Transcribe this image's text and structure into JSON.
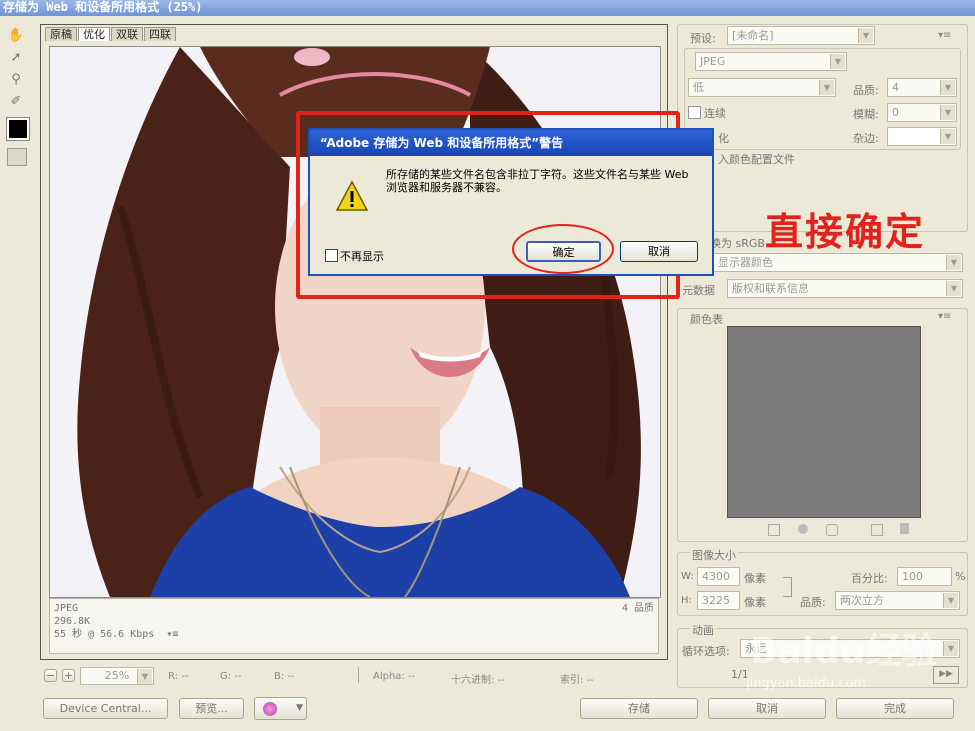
{
  "window": {
    "title": "存储为 Web 和设备所用格式 (25%)"
  },
  "tabs": [
    "原稿",
    "优化",
    "双联",
    "四联"
  ],
  "active_tab": 1,
  "info": {
    "format": "JPEG",
    "size": "296.8K",
    "time": "55 秒 @ 56.6 Kbps",
    "quality": "4 品质"
  },
  "statusbar": {
    "zoom": "25%",
    "r": "R: --",
    "g": "G: --",
    "b": "B: --",
    "alpha": "Alpha: --",
    "hex": "十六进制: --",
    "index": "索引: --"
  },
  "bottom": {
    "device_central": "Device Central...",
    "preview": "预览...",
    "save": "存储",
    "cancel": "取消",
    "done": "完成"
  },
  "right": {
    "preset_label": "预设:",
    "preset_value": "[未命名]",
    "format": "JPEG",
    "compression": "低",
    "quality_label": "品质:",
    "quality_value": "4",
    "progressive_label": "连续",
    "blur_label": "模糊:",
    "blur_value": "0",
    "optimized_partial": "化",
    "matte_label": "杂边:",
    "embed_profile": "入颜色配置文件",
    "convert_srgb": "换为 sRGB",
    "preview_value": "显示器颜色",
    "metadata_label": "元数据",
    "metadata_value": "版权和联系信息",
    "colortable_label": "颜色表",
    "image_size_label": "图像大小",
    "w_label": "W:",
    "w_value": "4300",
    "h_label": "H:",
    "h_value": "3225",
    "px_unit": "像素",
    "percent_label": "百分比:",
    "percent_value": "100",
    "percent_unit": "%",
    "resample_label": "品质:",
    "resample_value": "两次立方",
    "animation_label": "动画",
    "loop_label": "循环选项:",
    "loop_value": "永远",
    "frame_counter": "1/1"
  },
  "dialog": {
    "title": "“Adobe 存储为 Web 和设备所用格式”警告",
    "message": "所存储的某些文件名包含非拉丁字符。这些文件名与某些 Web 浏览器和服务器不兼容。",
    "checkbox": "不再显示",
    "ok": "确定",
    "cancel": "取消"
  },
  "annotation": {
    "text": "直接确定",
    "color": "#e3221b"
  },
  "watermark": {
    "brand": "Baidu经验",
    "url": "jingyan.baidu.com"
  },
  "colors": {
    "highlight": "#e3221b",
    "dialog_title": "#1d4fc1",
    "shirt": "#1d3fa8"
  }
}
